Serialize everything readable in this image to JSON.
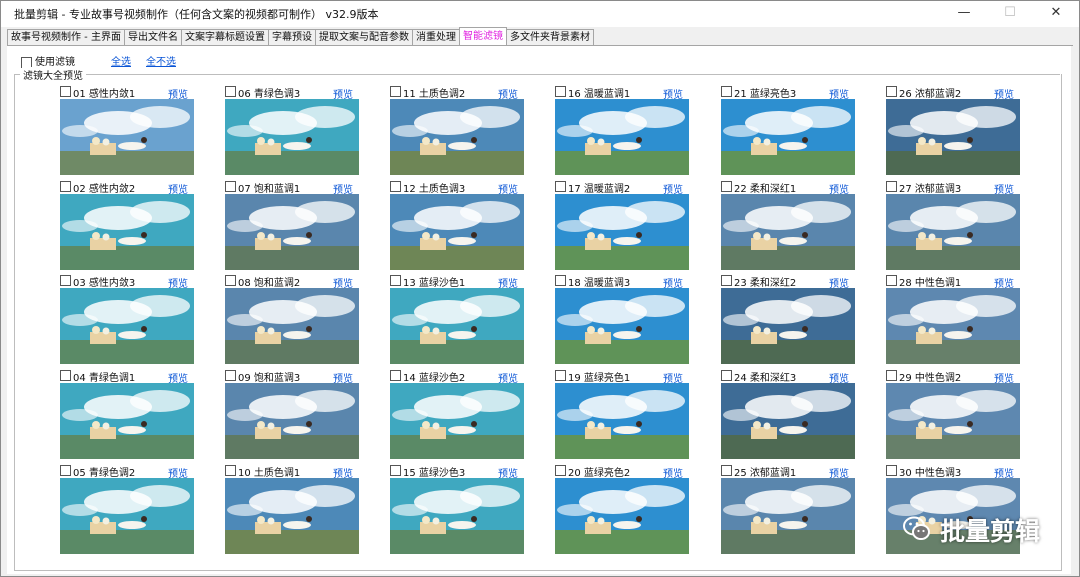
{
  "window": {
    "title": "批量剪辑 - 专业故事号视频制作（任何含文案的视频都可制作）  v32.9版本"
  },
  "tabs": [
    {
      "label": "故事号视频制作 - 主界面"
    },
    {
      "label": "导出文件名"
    },
    {
      "label": "文案字幕标题设置"
    },
    {
      "label": "字幕预设"
    },
    {
      "label": "提取文案与配音参数"
    },
    {
      "label": "消重处理"
    },
    {
      "label": "智能滤镜",
      "active": true
    },
    {
      "label": "多文件夹背景素材"
    }
  ],
  "controls": {
    "use_filter_label": "使用滤镜",
    "select_all": "全选",
    "select_none": "全不选"
  },
  "group_title": "滤镜大全预览",
  "preview_label": "预览",
  "columns": [
    [
      {
        "label": "01 感性内敛1",
        "hue": "cool"
      },
      {
        "label": "02 感性内敛2",
        "hue": "teal"
      },
      {
        "label": "03 感性内敛3",
        "hue": "teal"
      },
      {
        "label": "04 青绿色调1",
        "hue": "teal"
      },
      {
        "label": "05 青绿色调2",
        "hue": "teal"
      }
    ],
    [
      {
        "label": "06 青绿色调3",
        "hue": "teal"
      },
      {
        "label": "07 饱和蓝调1",
        "hue": "slate"
      },
      {
        "label": "08 饱和蓝调2",
        "hue": "slate"
      },
      {
        "label": "09 饱和蓝调3",
        "hue": "slate"
      },
      {
        "label": "10 土质色调1",
        "hue": "warm"
      }
    ],
    [
      {
        "label": "11 土质色调2",
        "hue": "warm"
      },
      {
        "label": "12 土质色调3",
        "hue": "warm"
      },
      {
        "label": "13 蓝绿沙色1",
        "hue": "teal"
      },
      {
        "label": "14 蓝绿沙色2",
        "hue": "teal"
      },
      {
        "label": "15 蓝绿沙色3",
        "hue": "teal"
      }
    ],
    [
      {
        "label": "16 温暖蓝调1",
        "hue": "blue"
      },
      {
        "label": "17 温暖蓝调2",
        "hue": "blue"
      },
      {
        "label": "18 温暖蓝调3",
        "hue": "blue"
      },
      {
        "label": "19 蓝绿亮色1",
        "hue": "blue"
      },
      {
        "label": "20 蓝绿亮色2",
        "hue": "blue"
      }
    ],
    [
      {
        "label": "21 蓝绿亮色3",
        "hue": "blue"
      },
      {
        "label": "22 柔和深红1",
        "hue": "slate"
      },
      {
        "label": "23 柔和深红2",
        "hue": "dark"
      },
      {
        "label": "24 柔和深红3",
        "hue": "dark"
      },
      {
        "label": "25 浓郁蓝调1",
        "hue": "slate"
      }
    ],
    [
      {
        "label": "26 浓郁蓝调2",
        "hue": "dark"
      },
      {
        "label": "27 浓郁蓝调3",
        "hue": "slate"
      },
      {
        "label": "28 中性色调1",
        "hue": "neutral"
      },
      {
        "label": "29 中性色调2",
        "hue": "neutral"
      },
      {
        "label": "30 中性色调3",
        "hue": "neutral"
      }
    ]
  ],
  "palettes": {
    "cool": {
      "sky": "#6aa2cf",
      "grass": "#6f8a66"
    },
    "teal": {
      "sky": "#3fa8c0",
      "grass": "#5a8a66"
    },
    "slate": {
      "sky": "#5a86ad",
      "grass": "#5f7a63"
    },
    "warm": {
      "sky": "#4d89b8",
      "grass": "#6e8656"
    },
    "blue": {
      "sky": "#2d8fd0",
      "grass": "#5f9358"
    },
    "dark": {
      "sky": "#3e6c96",
      "grass": "#4e6a53"
    },
    "neutral": {
      "sky": "#5e88b0",
      "grass": "#67806a"
    }
  },
  "watermark": {
    "text": "批量剪辑",
    "icon": "wechat-icon"
  }
}
